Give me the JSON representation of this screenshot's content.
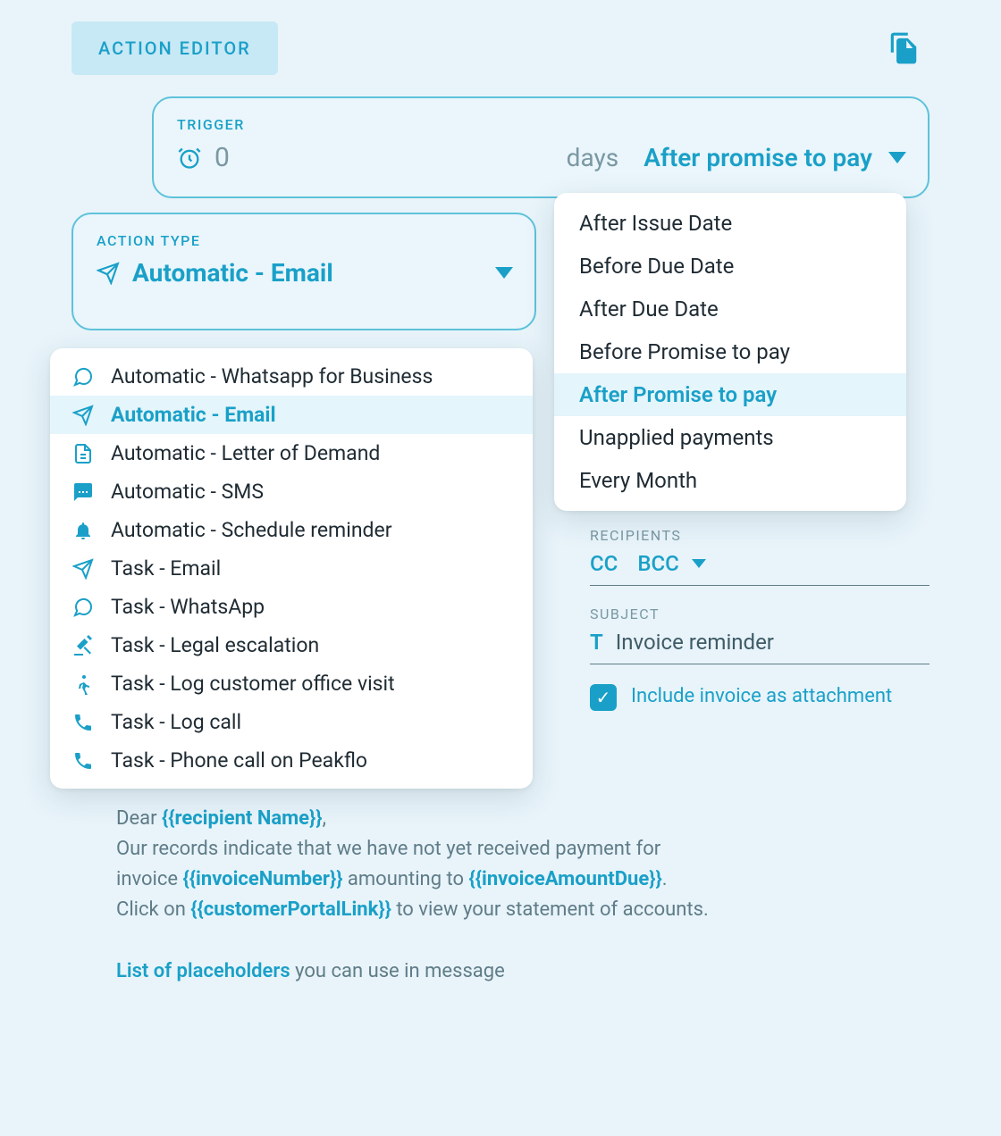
{
  "header": {
    "title": "ACTION EDITOR"
  },
  "trigger": {
    "label": "TRIGGER",
    "days_value": "0",
    "days_suffix": "days",
    "selected_label": "After promise to pay",
    "options": [
      {
        "label": "After Issue Date",
        "selected": false
      },
      {
        "label": "Before Due Date",
        "selected": false
      },
      {
        "label": "After Due Date",
        "selected": false
      },
      {
        "label": "Before Promise to pay",
        "selected": false
      },
      {
        "label": "After Promise to pay",
        "selected": true
      },
      {
        "label": "Unapplied payments",
        "selected": false
      },
      {
        "label": "Every Month",
        "selected": false
      }
    ]
  },
  "action_type": {
    "label": "ACTION TYPE",
    "selected_label": "Automatic - Email",
    "options": [
      {
        "icon": "whatsapp",
        "label": "Automatic - Whatsapp for Business",
        "selected": false
      },
      {
        "icon": "send",
        "label": "Automatic - Email",
        "selected": true
      },
      {
        "icon": "doc",
        "label": "Automatic - Letter of Demand",
        "selected": false
      },
      {
        "icon": "sms",
        "label": "Automatic - SMS",
        "selected": false
      },
      {
        "icon": "bell",
        "label": "Automatic - Schedule reminder",
        "selected": false
      },
      {
        "icon": "send",
        "label": "Task - Email",
        "selected": false
      },
      {
        "icon": "whatsapp",
        "label": "Task - WhatsApp",
        "selected": false
      },
      {
        "icon": "gavel",
        "label": "Task - Legal escalation",
        "selected": false
      },
      {
        "icon": "walk",
        "label": "Task - Log customer office visit",
        "selected": false
      },
      {
        "icon": "phone",
        "label": "Task - Log call",
        "selected": false
      },
      {
        "icon": "phone",
        "label": "Task - Phone call on Peakflo",
        "selected": false
      }
    ]
  },
  "recipients": {
    "label": "RECIPIENTS",
    "cc_label": "CC",
    "bcc_label": "BCC"
  },
  "subject": {
    "label": "SUBJECT",
    "value": "Invoice reminder"
  },
  "attachment": {
    "checked": true,
    "label": "Include invoice as attachment"
  },
  "body": {
    "l1a": "Dear ",
    "ph1": "{{recipient Name}}",
    "l1b": ",",
    "l2": "Our records indicate that we have not yet received payment for",
    "l3a": "invoice ",
    "ph2": "{{invoiceNumber}}",
    "l3b": " amounting to ",
    "ph3": "{{invoiceAmountDue}}",
    "l3c": ".",
    "l4a": "Click on ",
    "ph4": "{{customerPortalLink}}",
    "l4b": " to view your statement of accounts."
  },
  "placeholders_row": {
    "link_text": "List of placeholders",
    "suffix": " you can use in message"
  }
}
